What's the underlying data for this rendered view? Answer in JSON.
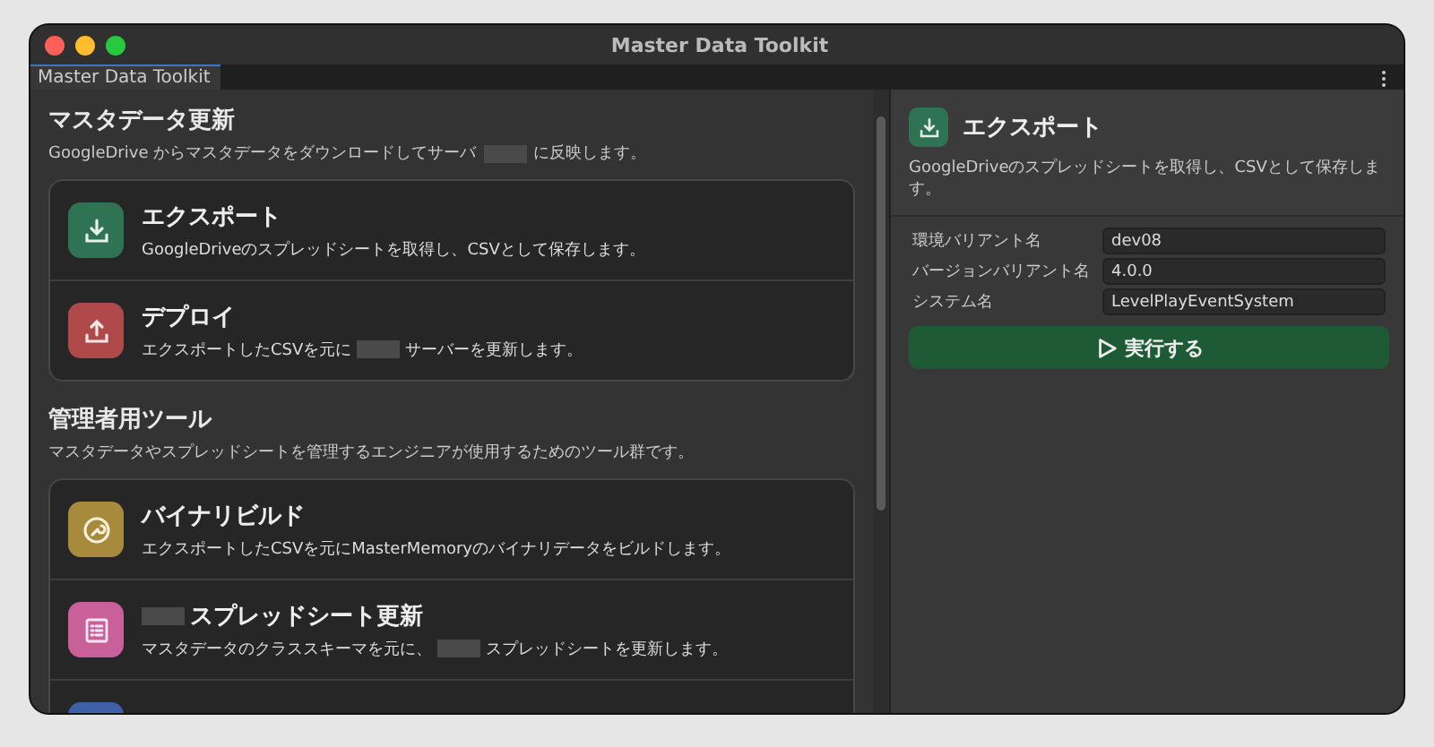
{
  "window": {
    "title": "Master Data Toolkit"
  },
  "tabs": [
    {
      "label": "Master Data Toolkit",
      "selected": true
    }
  ],
  "sections": [
    {
      "title": "マスタデータ更新",
      "description_parts": [
        "GoogleDrive からマスタデータをダウンロードしてサーバ",
        "に反映します。"
      ],
      "tools": [
        {
          "kind": "download",
          "color": "#2e7353",
          "title_redacted_prefix": false,
          "title": "エクスポート",
          "description_parts": [
            "GoogleDriveのスプレッドシートを取得し、CSVとして保存します。"
          ]
        },
        {
          "kind": "upload",
          "color": "#b04a4a",
          "title_redacted_prefix": false,
          "title": "デプロイ",
          "description_parts": [
            "エクスポートしたCSVを元に",
            "サーバーを更新します。"
          ]
        }
      ]
    },
    {
      "title": "管理者用ツール",
      "description_parts": [
        "マスタデータやスプレッドシートを管理するエンジニアが使用するためのツール群です。"
      ],
      "tools": [
        {
          "kind": "wrench",
          "color": "#a88a3c",
          "title_redacted_prefix": false,
          "title": "バイナリビルド",
          "description_parts": [
            "エクスポートしたCSVを元にMasterMemoryのバイナリデータをビルドします。"
          ]
        },
        {
          "kind": "list",
          "color": "#c9609a",
          "title_redacted_prefix": true,
          "title": "スプレッドシート更新",
          "description_parts": [
            "マスタデータのクラススキーマを元に、",
            "スプレッドシートを更新します。"
          ]
        },
        {
          "kind": "blank",
          "color": "#3f5fa8"
        }
      ]
    }
  ],
  "detail": {
    "kind": "download",
    "color": "#2e7353",
    "title": "エクスポート",
    "description": "GoogleDriveのスプレッドシートを取得し、CSVとして保存します。",
    "fields": [
      {
        "label": "環境バリアント名",
        "value": "dev08"
      },
      {
        "label": "バージョンバリアント名",
        "value": "4.0.0"
      },
      {
        "label": "システム名",
        "value": "LevelPlayEventSystem"
      }
    ],
    "run_button": {
      "label": "実行する"
    }
  }
}
